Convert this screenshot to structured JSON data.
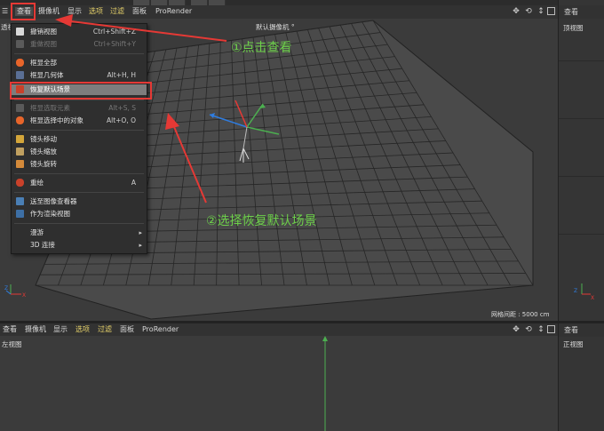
{
  "menubar": {
    "items": [
      "查看",
      "摄像机",
      "显示",
      "选项",
      "过滤",
      "面板",
      "ProRender"
    ],
    "hamburger": "☰"
  },
  "menubar_bottom": {
    "items": [
      "查看",
      "摄像机",
      "显示",
      "选项",
      "过滤",
      "面板",
      "ProRender"
    ]
  },
  "viewport_top": {
    "label_left": "透视",
    "camera_label": "默认摄像机 °",
    "grid_spacing": "网格间距 : 5000 cm"
  },
  "viewport_right_top": {
    "menu": "查看",
    "label": "顶视图"
  },
  "viewport_bottom": {
    "label": "左视图"
  },
  "viewport_right_bottom": {
    "menu": "查看",
    "label": "正视图"
  },
  "dropdown": {
    "items": [
      {
        "label": "撤销视图",
        "shortcut": "Ctrl+Shift+Z",
        "disabled": false,
        "icon": "undo-view-icon"
      },
      {
        "label": "重做视图",
        "shortcut": "Ctrl+Shift+Y",
        "disabled": true,
        "icon": "redo-view-icon"
      },
      {
        "label": "框显全部",
        "shortcut": "",
        "disabled": false,
        "icon": "frame-all-icon"
      },
      {
        "label": "框显几何体",
        "shortcut": "Alt+H, H",
        "disabled": false,
        "icon": "frame-geometry-icon"
      },
      {
        "label": "恢复默认场景",
        "shortcut": "",
        "disabled": false,
        "icon": "restore-scene-icon",
        "highlighted": true
      },
      {
        "label": "框显选取元素",
        "shortcut": "Alt+S, S",
        "disabled": true,
        "icon": "frame-selected-elements-icon"
      },
      {
        "label": "框显选择中的对象",
        "shortcut": "Alt+O, O",
        "disabled": false,
        "icon": "frame-selected-objects-icon"
      },
      {
        "label": "镜头移动",
        "shortcut": "",
        "disabled": false,
        "icon": "camera-move-icon"
      },
      {
        "label": "镜头缩放",
        "shortcut": "",
        "disabled": false,
        "icon": "camera-zoom-icon"
      },
      {
        "label": "镜头旋转",
        "shortcut": "",
        "disabled": false,
        "icon": "camera-rotate-icon"
      },
      {
        "label": "重绘",
        "shortcut": "A",
        "disabled": false,
        "icon": "redraw-icon"
      },
      {
        "label": "送至图像查看器",
        "shortcut": "",
        "disabled": false,
        "icon": "send-to-picture-viewer-icon"
      },
      {
        "label": "作为渲染视图",
        "shortcut": "",
        "disabled": false,
        "icon": "as-render-view-icon"
      },
      {
        "label": "漫游",
        "shortcut": "",
        "disabled": false,
        "submenu": true
      },
      {
        "label": "3D 连接",
        "shortcut": "",
        "disabled": false,
        "submenu": true
      }
    ]
  },
  "annotations": {
    "step1": "①点击查看",
    "step2": "②选择恢复默认场景"
  },
  "colors": {
    "annotation_green": "#6dd04a",
    "highlight_red": "#e53935",
    "menu_yellow": "#e8d36a",
    "axis_x": "#e53935",
    "axis_y": "#4caf50",
    "axis_z": "#2f7de1"
  }
}
